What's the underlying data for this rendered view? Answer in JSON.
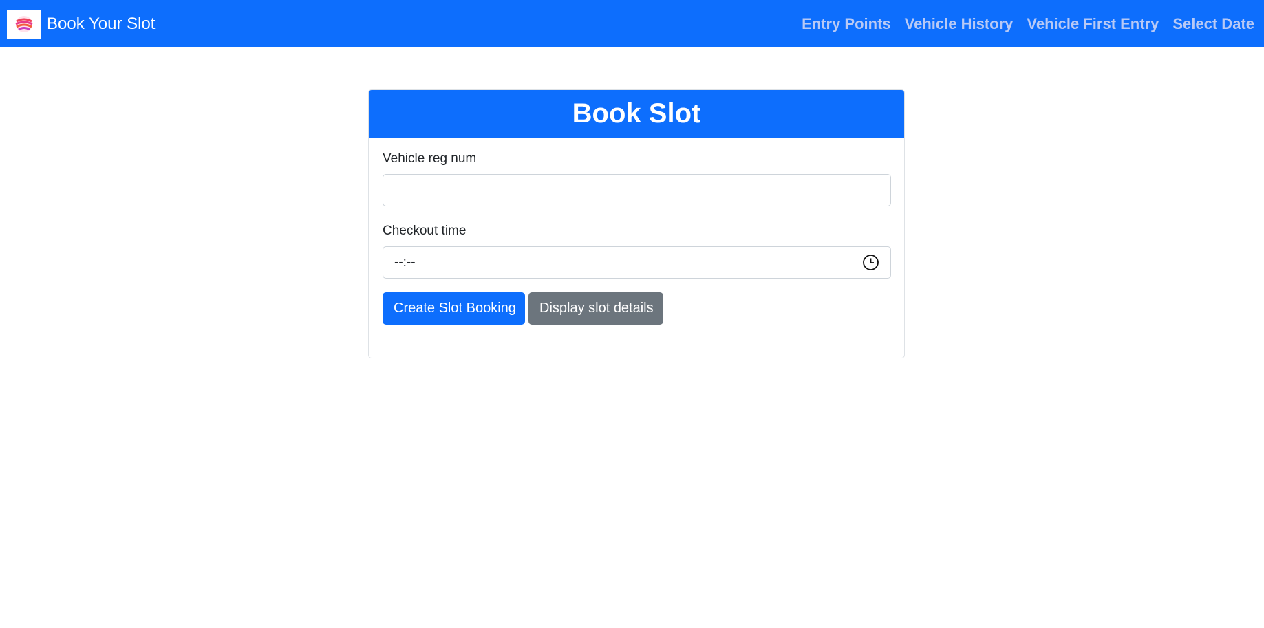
{
  "navbar": {
    "brand": "Book Your Slot",
    "logo_icon": "swirl-logo-icon",
    "links": [
      {
        "label": "Entry Points"
      },
      {
        "label": "Vehicle History"
      },
      {
        "label": "Vehicle First Entry"
      },
      {
        "label": "Select Date"
      }
    ]
  },
  "card": {
    "title": "Book Slot",
    "reg_label": "Vehicle reg num",
    "reg_value": "",
    "time_label": "Checkout time",
    "time_placeholder": "--:--",
    "create_button": "Create Slot Booking",
    "display_button": "Display slot details"
  },
  "colors": {
    "primary": "#0d6efd",
    "secondary": "#6c757d",
    "nav_link": "#b8c9f5"
  }
}
